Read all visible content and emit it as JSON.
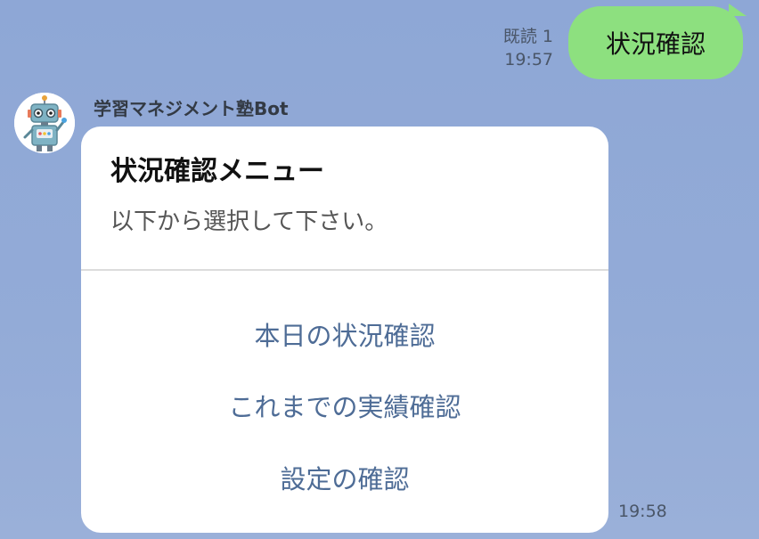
{
  "outgoing": {
    "read_label": "既読 1",
    "time": "19:57",
    "text": "状況確認"
  },
  "incoming": {
    "sender_name": "学習マネジメント塾Bot",
    "time": "19:58",
    "card": {
      "title": "状況確認メニュー",
      "text": "以下から選択して下さい。",
      "actions": [
        "本日の状況確認",
        "これまでの実績確認",
        "設定の確認"
      ]
    }
  },
  "colors": {
    "background": "#8fa8d6",
    "outgoing_bubble": "#8de07f",
    "action_text": "#4e6c96"
  },
  "icons": {
    "avatar": "robot-avatar-icon"
  }
}
